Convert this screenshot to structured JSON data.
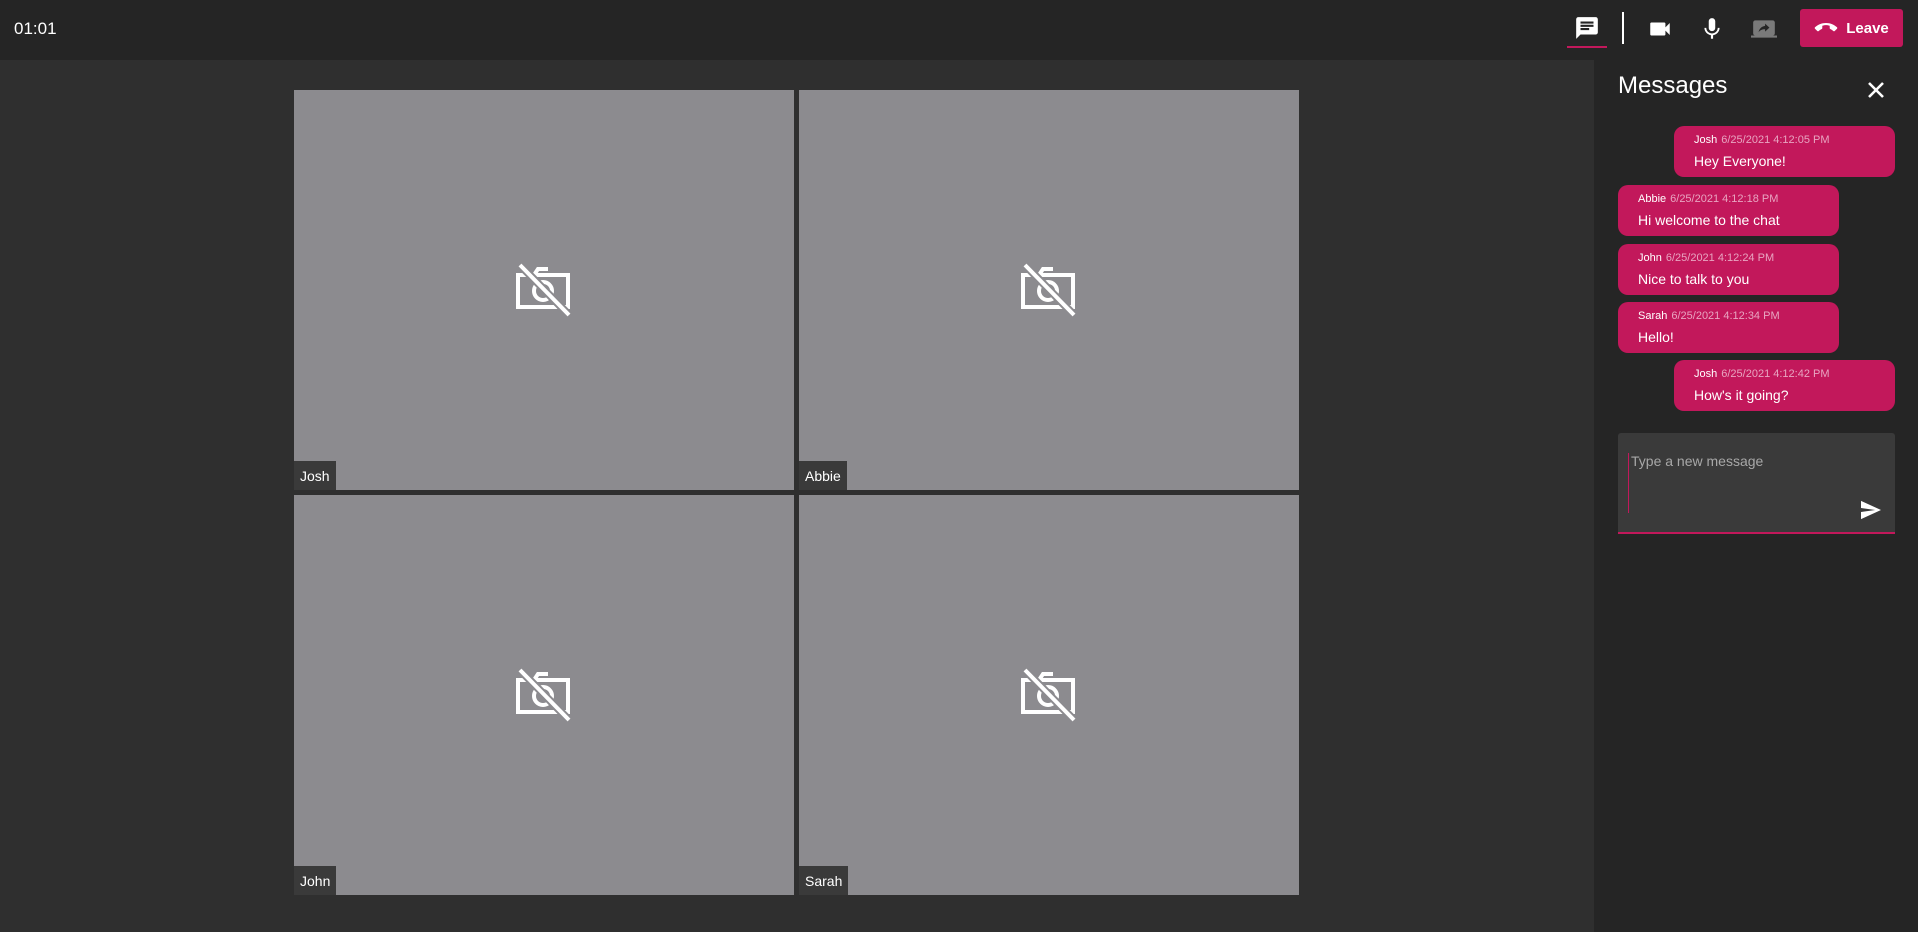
{
  "header": {
    "timer": "01:01",
    "leave_label": "Leave"
  },
  "icons": {
    "chat": "chat-icon",
    "camera": "video-camera-icon",
    "mic": "microphone-icon",
    "share": "screen-share-icon",
    "leave": "phone-hangup-icon",
    "camera_off": "camera-off-icon",
    "close": "close-icon",
    "send": "send-icon"
  },
  "participants": [
    {
      "name": "Josh"
    },
    {
      "name": "Abbie"
    },
    {
      "name": "John"
    },
    {
      "name": "Sarah"
    }
  ],
  "chat": {
    "title": "Messages",
    "messages": [
      {
        "author": "Josh",
        "time": "6/25/2021 4:12:05 PM",
        "text": "Hey Everyone!"
      },
      {
        "author": "Abbie",
        "time": "6/25/2021 4:12:18 PM",
        "text": "Hi welcome to the chat"
      },
      {
        "author": "John",
        "time": "6/25/2021 4:12:24 PM",
        "text": "Nice to talk to you"
      },
      {
        "author": "Sarah",
        "time": "6/25/2021 4:12:34 PM",
        "text": "Hello!"
      },
      {
        "author": "Josh",
        "time": "6/25/2021 4:12:42 PM",
        "text": "How's it going?"
      }
    ],
    "input_placeholder": "Type a new message",
    "input_value": ""
  },
  "colors": {
    "accent": "#c2185b",
    "topbar": "#252525",
    "stage": "#2f2f2f",
    "tile": "#8c8b8f"
  }
}
